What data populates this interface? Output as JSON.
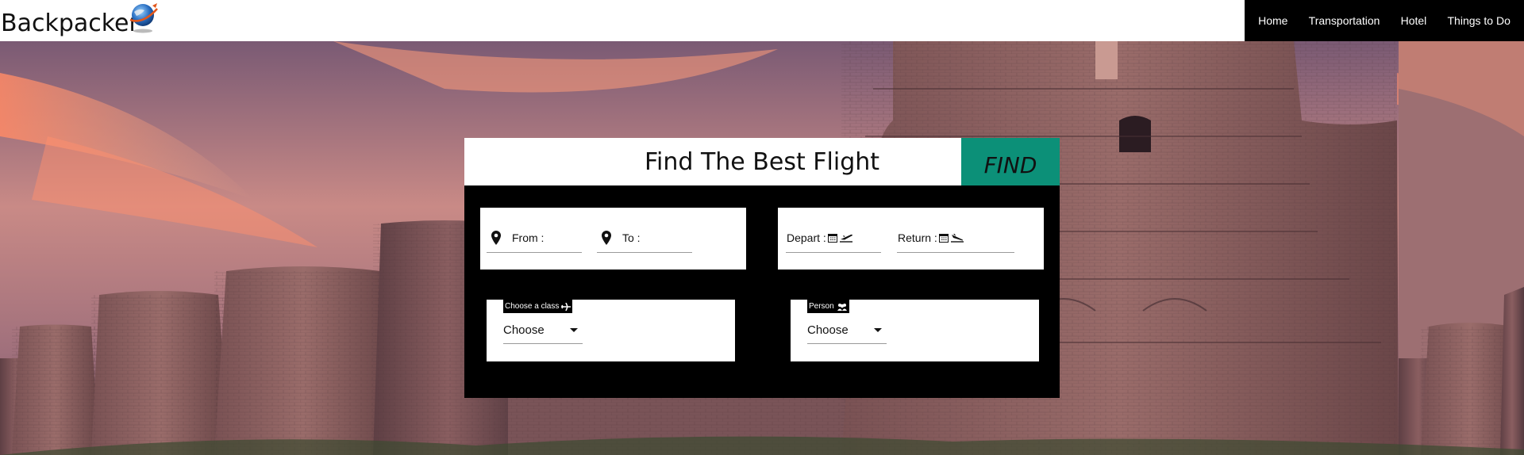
{
  "header": {
    "brand": "Backpacker",
    "nav": [
      {
        "label": "Home"
      },
      {
        "label": "Transportation"
      },
      {
        "label": "Hotel"
      },
      {
        "label": "Things to Do"
      }
    ]
  },
  "search": {
    "title": "Find The Best Flight",
    "find_label": "FIND",
    "from_label": "From :",
    "to_label": "To :",
    "depart_label": "Depart :",
    "return_label": "Return :",
    "class_label": "Choose a class",
    "class_value": "Choose",
    "person_label": "Person",
    "person_value": "Choose"
  },
  "colors": {
    "accent": "#0c9078",
    "nav_bg": "#000000",
    "card_bg": "#000000"
  }
}
